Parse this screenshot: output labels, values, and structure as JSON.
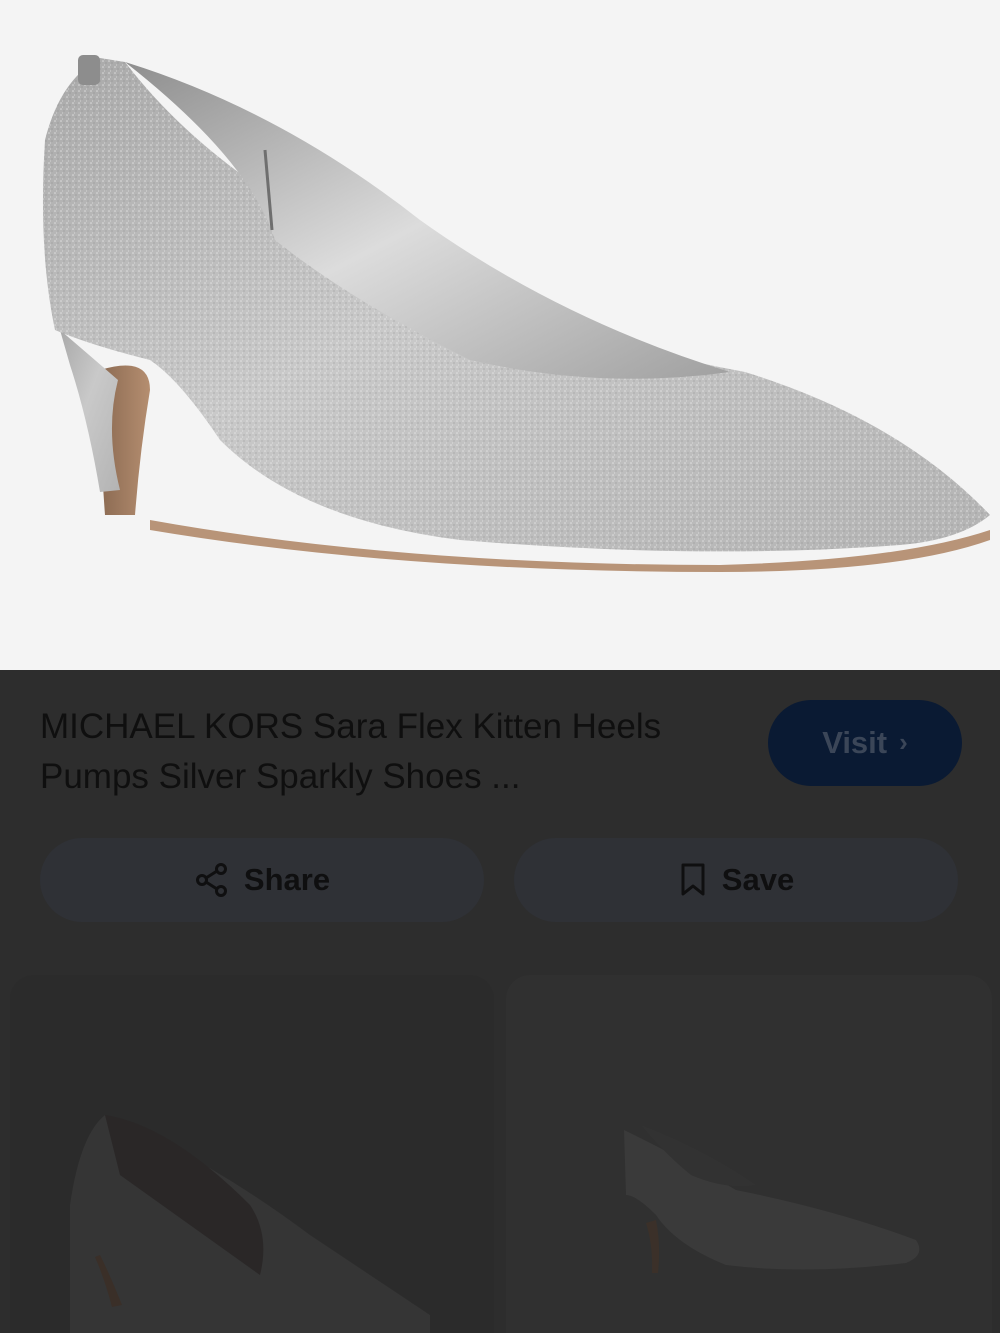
{
  "product": {
    "title": "MICHAEL KORS Sara Flex Kitten Heels Pumps Silver Sparkly Shoes ...",
    "image_alt": "silver glitter kitten heel pump"
  },
  "actions": {
    "visit_label": "Visit",
    "visit_icon": "chevron-right-icon",
    "share_label": "Share",
    "share_icon": "share-icon",
    "save_label": "Save",
    "save_icon": "bookmark-icon"
  },
  "related": [
    {
      "image_alt": "dark glitter kitten heel pump"
    },
    {
      "image_alt": "grey glitter kitten heel pump"
    }
  ],
  "colors": {
    "hero_bg": "#f4f4f4",
    "panel_bg": "#2d2d2d",
    "visit_bg": "#0a1a33",
    "button_bg": "#2f3136"
  }
}
